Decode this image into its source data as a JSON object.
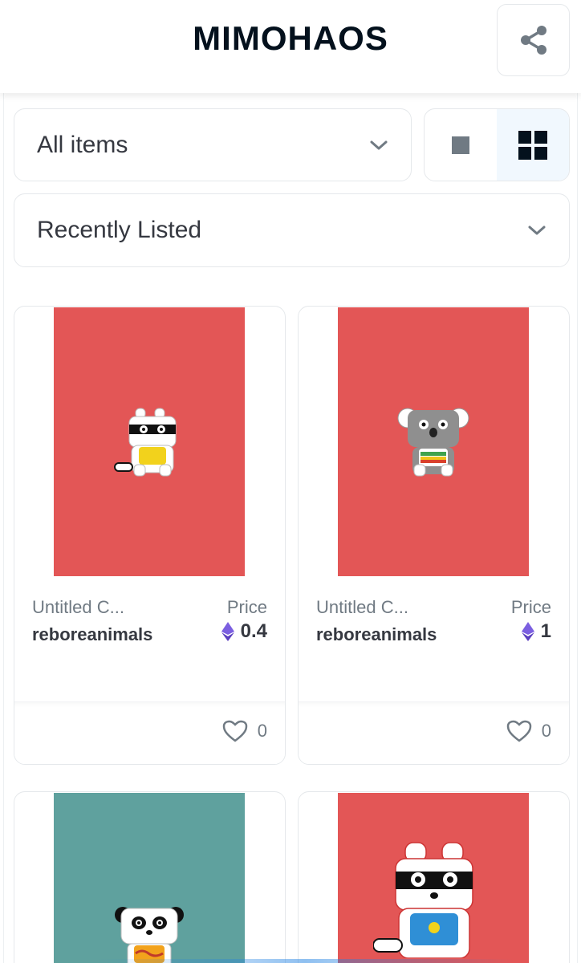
{
  "header": {
    "title": "MIMOHAOS"
  },
  "filters": {
    "items_select": {
      "label": "All items"
    },
    "sort_select": {
      "label": "Recently Listed"
    }
  },
  "view_toggle": {
    "active": "grid",
    "options": [
      "single",
      "grid"
    ]
  },
  "colors": {
    "card_red": "#e35656",
    "card_teal": "#5fa19e",
    "eth_purple": "#7b5fe0",
    "toggle_active_bg": "#f1f8fe"
  },
  "cards": [
    {
      "name": "Untitled C...",
      "creator": "reboreanimals",
      "price_label": "Price",
      "price": "0.4",
      "likes": "0",
      "bg": "red",
      "art": "raccoon-yellow-shirt"
    },
    {
      "name": "Untitled C...",
      "creator": "reboreanimals",
      "price_label": "Price",
      "price": "1",
      "likes": "0",
      "bg": "red",
      "art": "koala-green-shirt"
    },
    {
      "bg": "teal",
      "art": "panda-orange-shirt"
    },
    {
      "bg": "red",
      "art": "raccoon-blue-overalls"
    }
  ],
  "icons": {
    "share": "share-icon",
    "chevron": "chevron-down-icon",
    "single_view": "square-icon",
    "grid_view": "grid-icon",
    "currency": "ethereum-icon",
    "favorite": "heart-icon"
  }
}
